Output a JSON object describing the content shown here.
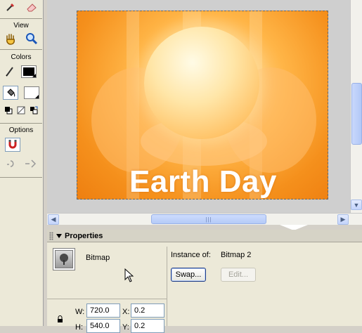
{
  "tools": {
    "top_icons": [
      "eyedropper-icon",
      "eraser-icon"
    ],
    "view_label": "View",
    "view_icons": [
      "hand-icon",
      "zoom-icon"
    ],
    "colors_label": "Colors",
    "stroke_color": "#000000",
    "fill_color": "#ffffff",
    "options_label": "Options"
  },
  "stage": {
    "title_text": "Earth Day",
    "accent_orange": "#f5901c"
  },
  "scrollbar": {
    "thumb_grip": "|||"
  },
  "properties": {
    "title": "Properties",
    "symbol_type": "Bitmap",
    "instance_of_label": "Instance of:",
    "instance_of_value": "Bitmap 2",
    "swap_label": "Swap...",
    "edit_label": "Edit...",
    "w_label": "W:",
    "w_value": "720.0",
    "h_label": "H:",
    "h_value": "540.0",
    "x_label": "X:",
    "x_value": "0.2",
    "y_label": "Y:",
    "y_value": "0.2"
  }
}
